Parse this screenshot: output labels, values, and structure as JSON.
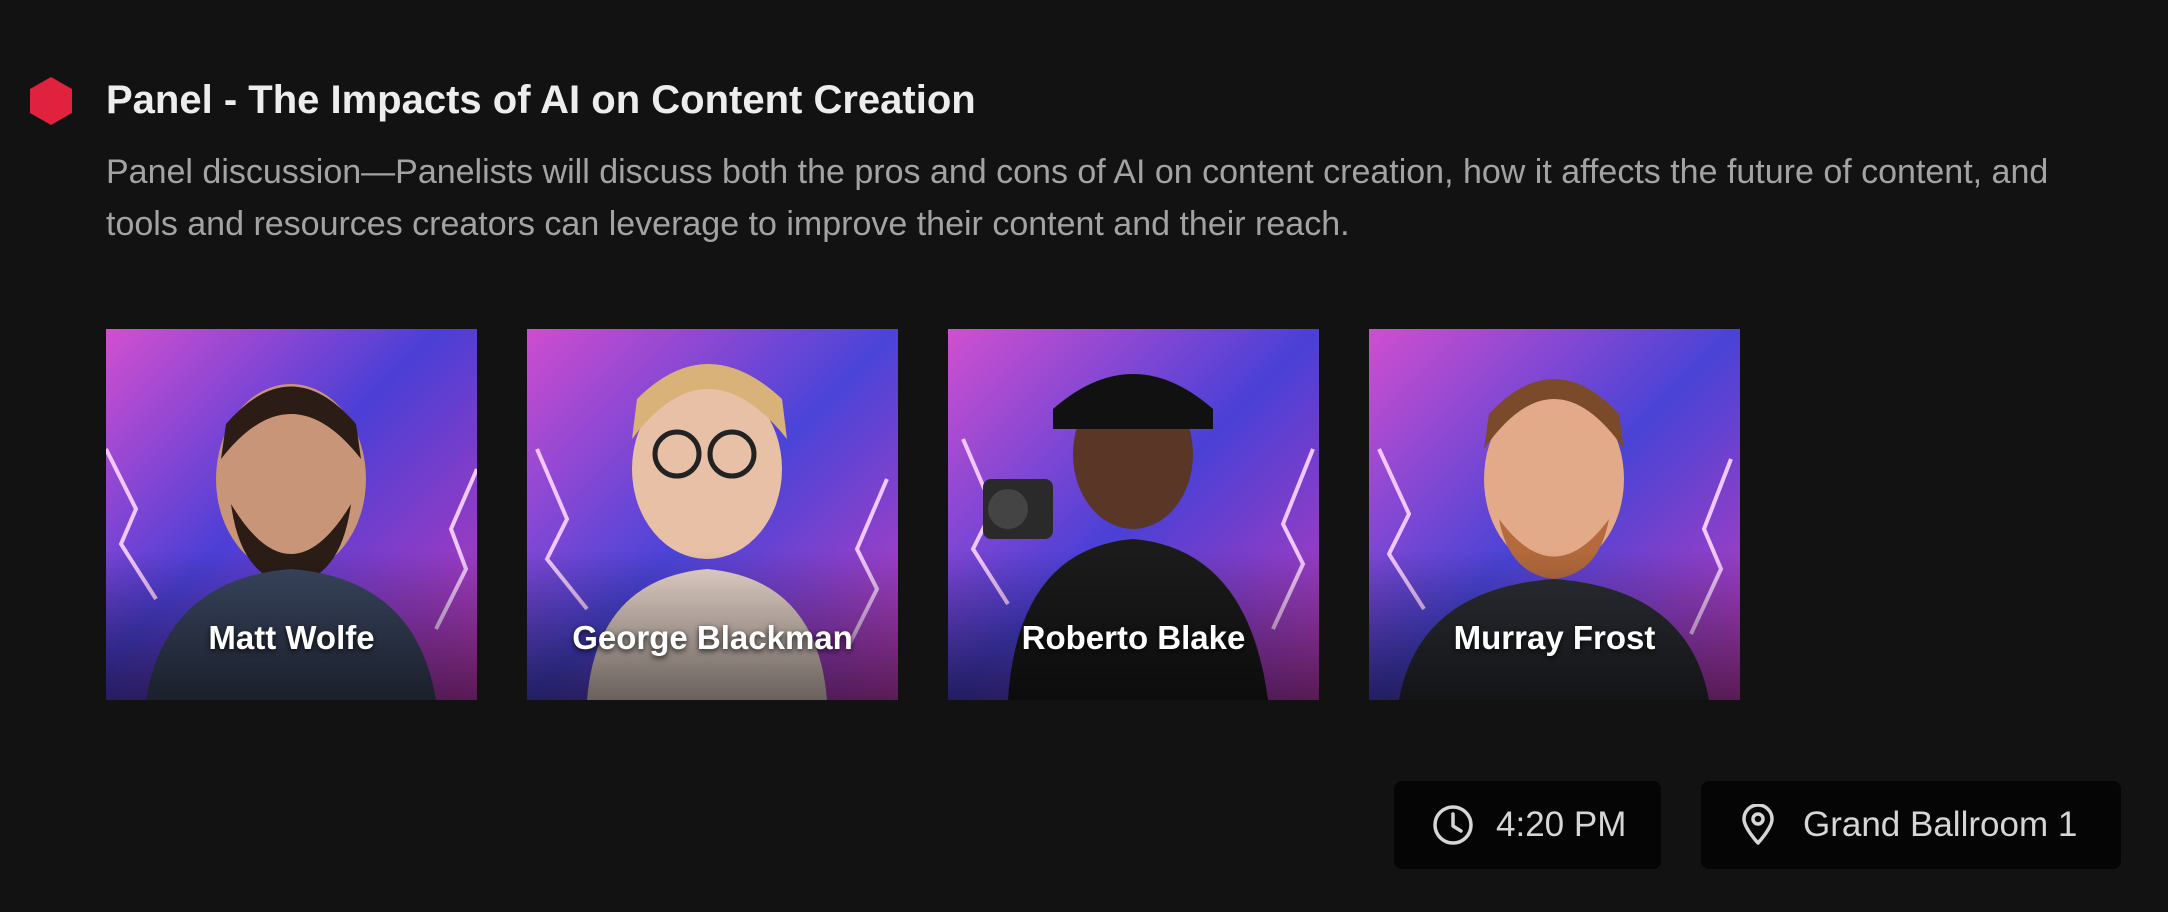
{
  "session": {
    "title": "Panel - The Impacts of AI on Content Creation",
    "description": "Panel discussion—Panelists will discuss both the pros and cons of AI on content creation, how it affects the future of content, and tools and resources creators can leverage to improve their content and their reach.",
    "accent_color": "#e0223f",
    "marker_icon": "hexagon-icon"
  },
  "speakers": [
    {
      "name": "Matt Wolfe",
      "image": "speaker-photo"
    },
    {
      "name": "George Blackman",
      "image": "speaker-photo"
    },
    {
      "name": "Roberto Blake",
      "image": "speaker-photo"
    },
    {
      "name": "Murray Frost",
      "image": "speaker-photo"
    }
  ],
  "details": {
    "time": {
      "icon": "clock-icon",
      "label": "4:20 PM"
    },
    "location": {
      "icon": "location-pin-icon",
      "label": "Grand Ballroom 1"
    }
  },
  "colors": {
    "background": "#121212",
    "chip_background": "#050505",
    "description_text": "#a3a3a3"
  }
}
